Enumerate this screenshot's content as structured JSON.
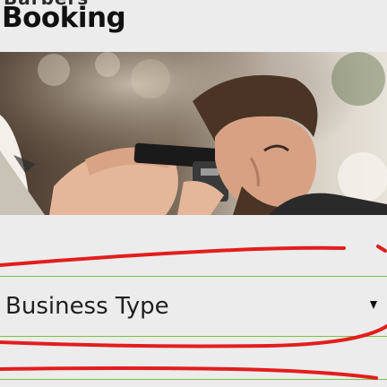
{
  "header": {
    "partial_text": "Barbers",
    "title": "Booking"
  },
  "hero": {
    "icon": "barber-photo-image"
  },
  "form": {
    "business_type_label": "Business Type"
  },
  "colors": {
    "divider": "#7ac143",
    "annotation": "#e31d1d",
    "background": "#ececec"
  }
}
